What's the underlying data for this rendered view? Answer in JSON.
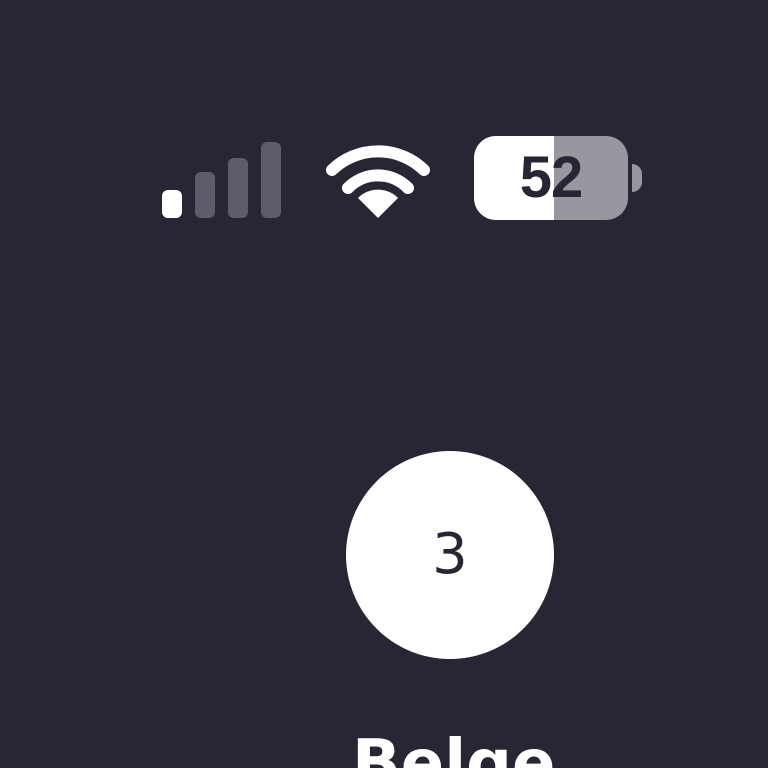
{
  "status_bar": {
    "signal": {
      "bars_total": 4,
      "bars_active": 1,
      "active_color": "#ffffff",
      "inactive_color": "#5d5c68",
      "icon": "cellular-signal-icon"
    },
    "wifi": {
      "icon": "wifi-icon",
      "color": "#ffffff"
    },
    "battery": {
      "level_text": "52",
      "level_percent": 52,
      "icon": "battery-icon",
      "fill_color": "#ffffff",
      "empty_color": "#98979f"
    }
  },
  "main": {
    "step_number": "3",
    "name": "Belge"
  },
  "colors": {
    "background": "#272634",
    "foreground": "#ffffff"
  }
}
